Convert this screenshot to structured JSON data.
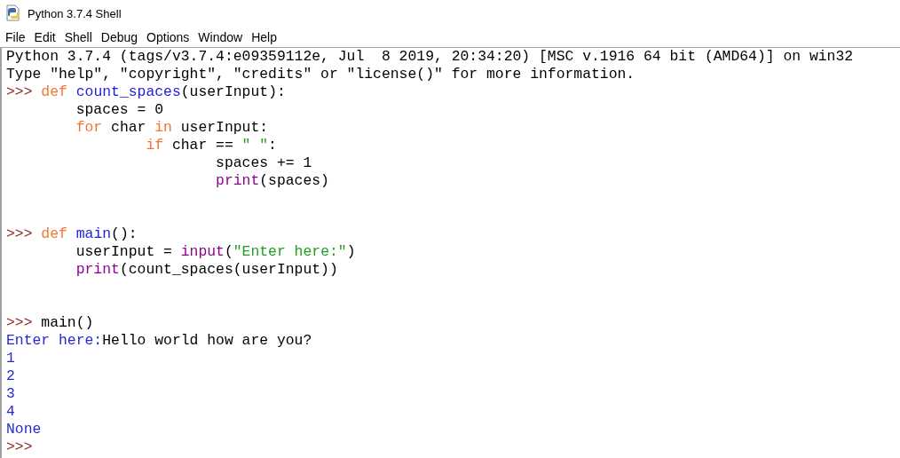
{
  "window": {
    "title": "Python 3.7.4 Shell"
  },
  "menu": [
    "File",
    "Edit",
    "Shell",
    "Debug",
    "Options",
    "Window",
    "Help"
  ],
  "shell_lines": [
    {
      "kind": "text",
      "segments": [
        {
          "kind": "plain",
          "text": "Python 3.7.4 (tags/v3.7.4:e09359112e, Jul  8 2019, 20:34:20) [MSC v.1916 64 bit (AMD64)] on win32"
        }
      ]
    },
    {
      "kind": "text",
      "segments": [
        {
          "kind": "plain",
          "text": "Type \"help\", \"copyright\", \"credits\" or \"license()\" for more information."
        }
      ]
    },
    {
      "kind": "text",
      "segments": [
        {
          "kind": "prompt",
          "text": ">>> "
        },
        {
          "kind": "keyword",
          "text": "def "
        },
        {
          "kind": "definition",
          "text": "count_spaces"
        },
        {
          "kind": "plain",
          "text": "(userInput):"
        }
      ]
    },
    {
      "kind": "text",
      "segments": [
        {
          "kind": "plain",
          "text": "        spaces = 0"
        }
      ]
    },
    {
      "kind": "text",
      "segments": [
        {
          "kind": "keyword",
          "text": "        for"
        },
        {
          "kind": "plain",
          "text": " char "
        },
        {
          "kind": "keyword",
          "text": "in"
        },
        {
          "kind": "plain",
          "text": " userInput:"
        }
      ]
    },
    {
      "kind": "text",
      "segments": [
        {
          "kind": "keyword",
          "text": "                if"
        },
        {
          "kind": "plain",
          "text": " char == "
        },
        {
          "kind": "string",
          "text": "\" \""
        },
        {
          "kind": "plain",
          "text": ":"
        }
      ]
    },
    {
      "kind": "text",
      "segments": [
        {
          "kind": "plain",
          "text": "                        spaces += 1"
        }
      ]
    },
    {
      "kind": "text",
      "segments": [
        {
          "kind": "builtin",
          "text": "                        print"
        },
        {
          "kind": "plain",
          "text": "(spaces)"
        }
      ]
    },
    {
      "kind": "blank"
    },
    {
      "kind": "blank"
    },
    {
      "kind": "text",
      "segments": [
        {
          "kind": "prompt",
          "text": ">>> "
        },
        {
          "kind": "keyword",
          "text": "def "
        },
        {
          "kind": "definition",
          "text": "main"
        },
        {
          "kind": "plain",
          "text": "():"
        }
      ]
    },
    {
      "kind": "text",
      "segments": [
        {
          "kind": "plain",
          "text": "        userInput = "
        },
        {
          "kind": "builtin",
          "text": "input"
        },
        {
          "kind": "plain",
          "text": "("
        },
        {
          "kind": "string",
          "text": "\"Enter here:\""
        },
        {
          "kind": "plain",
          "text": ")"
        }
      ]
    },
    {
      "kind": "text",
      "segments": [
        {
          "kind": "builtin",
          "text": "        print"
        },
        {
          "kind": "plain",
          "text": "(count_spaces(userInput))"
        }
      ]
    },
    {
      "kind": "blank"
    },
    {
      "kind": "blank"
    },
    {
      "kind": "text",
      "segments": [
        {
          "kind": "prompt",
          "text": ">>> "
        },
        {
          "kind": "plain",
          "text": "main()"
        }
      ]
    },
    {
      "kind": "text",
      "segments": [
        {
          "kind": "stdout",
          "text": "Enter here:"
        },
        {
          "kind": "plain",
          "text": "Hello world how are you?"
        }
      ]
    },
    {
      "kind": "text",
      "segments": [
        {
          "kind": "stdout",
          "text": "1"
        }
      ]
    },
    {
      "kind": "text",
      "segments": [
        {
          "kind": "stdout",
          "text": "2"
        }
      ]
    },
    {
      "kind": "text",
      "segments": [
        {
          "kind": "stdout",
          "text": "3"
        }
      ]
    },
    {
      "kind": "text",
      "segments": [
        {
          "kind": "stdout",
          "text": "4"
        }
      ]
    },
    {
      "kind": "text",
      "segments": [
        {
          "kind": "stdout",
          "text": "None"
        }
      ]
    },
    {
      "kind": "text",
      "segments": [
        {
          "kind": "prompt",
          "text": ">>> "
        }
      ]
    }
  ]
}
